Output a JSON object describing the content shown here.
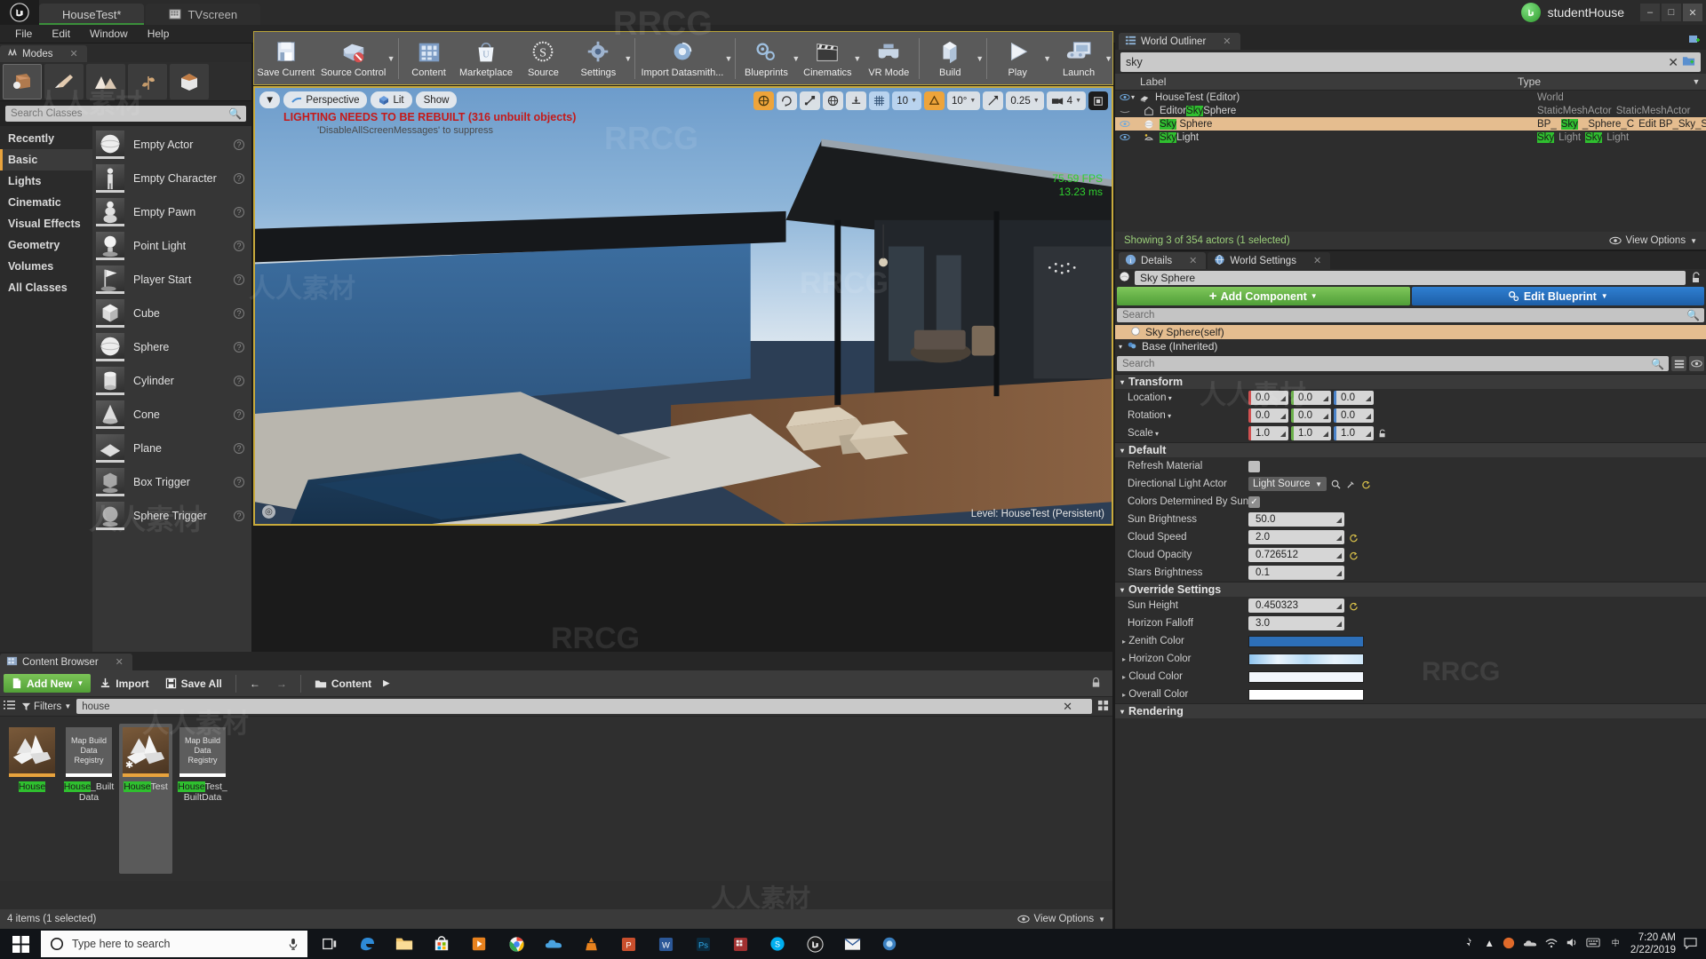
{
  "title_bar": {
    "tabs": [
      {
        "label": "HouseTest*",
        "icon": "unreal-logo-icon",
        "active": true
      },
      {
        "label": "TVscreen",
        "icon": "tvscreen-icon",
        "active": false
      }
    ],
    "account_name": "studentHouse",
    "window_controls": [
      "minimize",
      "maximize",
      "close"
    ]
  },
  "menu_bar": {
    "items": [
      "File",
      "Edit",
      "Window",
      "Help"
    ]
  },
  "modes_panel": {
    "tab_label": "Modes",
    "mode_buttons": [
      "place-mode-icon",
      "paint-mode-icon",
      "landscape-mode-icon",
      "foliage-mode-icon",
      "geometry-mode-icon"
    ],
    "search_placeholder": "Search Classes",
    "search_value": "",
    "categories": [
      {
        "label": "Recently Placed",
        "active": false
      },
      {
        "label": "Basic",
        "active": true
      },
      {
        "label": "Lights",
        "active": false
      },
      {
        "label": "Cinematic",
        "active": false
      },
      {
        "label": "Visual Effects",
        "active": false
      },
      {
        "label": "Geometry",
        "active": false
      },
      {
        "label": "Volumes",
        "active": false
      },
      {
        "label": "All Classes",
        "active": false
      }
    ],
    "placeables": [
      {
        "label": "Empty Actor",
        "icon": "sphere-thumb"
      },
      {
        "label": "Empty Character",
        "icon": "character-thumb"
      },
      {
        "label": "Empty Pawn",
        "icon": "pawn-thumb"
      },
      {
        "label": "Point Light",
        "icon": "bulb-thumb"
      },
      {
        "label": "Player Start",
        "icon": "flag-thumb"
      },
      {
        "label": "Cube",
        "icon": "cube-thumb"
      },
      {
        "label": "Sphere",
        "icon": "sphere-thumb"
      },
      {
        "label": "Cylinder",
        "icon": "cylinder-thumb"
      },
      {
        "label": "Cone",
        "icon": "cone-thumb"
      },
      {
        "label": "Plane",
        "icon": "plane-thumb"
      },
      {
        "label": "Box Trigger",
        "icon": "boxtrigger-thumb"
      },
      {
        "label": "Sphere Trigger",
        "icon": "spheretrigger-thumb"
      }
    ]
  },
  "main_toolbar": {
    "items": [
      {
        "label": "Save Current",
        "icon": "floppy-icon",
        "caret": false
      },
      {
        "label": "Source Control",
        "icon": "source-control-icon",
        "caret": true
      },
      {
        "label": "Content",
        "icon": "content-grid-icon",
        "caret": false
      },
      {
        "label": "Marketplace",
        "icon": "marketplace-bag-icon",
        "caret": false
      },
      {
        "label": "Source",
        "icon": "source-s-icon",
        "caret": false
      },
      {
        "label": "Settings",
        "icon": "settings-gear-icon",
        "caret": true
      },
      {
        "label": "Import Datasmith...",
        "icon": "datasmith-icon",
        "caret": true
      },
      {
        "label": "Blueprints",
        "icon": "blueprint-icon",
        "caret": true
      },
      {
        "label": "Cinematics",
        "icon": "clapperboard-icon",
        "caret": true
      },
      {
        "label": "VR Mode",
        "icon": "vr-headset-icon",
        "caret": false
      },
      {
        "label": "Build",
        "icon": "build-icon",
        "caret": true
      },
      {
        "label": "Play",
        "icon": "play-triangle-icon",
        "caret": true
      },
      {
        "label": "Launch",
        "icon": "launch-gamepad-icon",
        "caret": true
      }
    ]
  },
  "viewport": {
    "view_caret": "viewport-options-caret",
    "perspective_label": "Perspective",
    "lit_label": "Lit",
    "show_label": "Show",
    "warning_line1": "LIGHTING NEEDS TO BE REBUILT (316 unbuilt objects)",
    "warning_line2": "'DisableAllScreenMessages' to suppress",
    "fps": "75.59 FPS",
    "frame_ms": "13.23 ms",
    "level_label": "Level:  HouseTest (Persistent)",
    "right_controls": [
      {
        "name": "transform-mode-icon",
        "value": ""
      },
      {
        "name": "rotate-mode-icon",
        "value": ""
      },
      {
        "name": "scale-mode-icon",
        "value": ""
      },
      {
        "name": "world-coords-icon",
        "value": ""
      },
      {
        "name": "surface-snap-icon",
        "value": ""
      },
      {
        "name": "grid-snap-icon",
        "value": ""
      },
      {
        "name": "grid-size-value",
        "value": "10"
      },
      {
        "name": "rotation-snap-icon",
        "value": ""
      },
      {
        "name": "rotation-snap-value",
        "value": "10°"
      },
      {
        "name": "scale-snap-icon",
        "value": ""
      },
      {
        "name": "scale-snap-value",
        "value": "0.25"
      },
      {
        "name": "camera-speed-icon",
        "value": ""
      },
      {
        "name": "camera-speed-value",
        "value": "4"
      },
      {
        "name": "maximize-viewport-icon",
        "value": ""
      }
    ]
  },
  "content_browser": {
    "tab_label": "Content Browser",
    "add_new_label": "Add New",
    "import_label": "Import",
    "save_all_label": "Save All",
    "breadcrumb": "Content",
    "filters_label": "Filters",
    "search_value": "house",
    "assets": [
      {
        "name_plain": "House",
        "name_parts": [
          {
            "t": "House",
            "hl": true
          }
        ],
        "type": "level",
        "selected": false
      },
      {
        "name_plain": "House_BuiltData",
        "name_parts": [
          {
            "t": "House",
            "hl": true
          },
          {
            "t": "_Built",
            "hl": false
          },
          {
            "t": "Data",
            "hl": false
          }
        ],
        "type": "mapbuild",
        "thumb_text": "Map Build Data Registry",
        "selected": false
      },
      {
        "name_plain": "HouseTest",
        "name_parts": [
          {
            "t": "House",
            "hl": true
          },
          {
            "t": "Test",
            "hl": false
          }
        ],
        "type": "level",
        "selected": true
      },
      {
        "name_plain": "HouseTest_BuiltData",
        "name_parts": [
          {
            "t": "House",
            "hl": true
          },
          {
            "t": "Test_",
            "hl": false
          },
          {
            "t": "BuiltData",
            "hl": false
          }
        ],
        "type": "mapbuild",
        "thumb_text": "Map Build Data Registry",
        "selected": false
      }
    ],
    "status_text": "4 items (1 selected)",
    "view_options_label": "View Options"
  },
  "world_outliner": {
    "tab_label": "World Outliner",
    "search_value": "sky",
    "columns": {
      "label": "Label",
      "type": "Type"
    },
    "rows": [
      {
        "label_parts": [
          {
            "t": "HouseTest (Editor)",
            "hl": false
          }
        ],
        "type_parts": [
          {
            "t": "World",
            "hl": false
          }
        ],
        "depth": 0,
        "icon": "world-icon",
        "eye": true,
        "selected": false,
        "expander": true
      },
      {
        "label_parts": [
          {
            "t": "Editor",
            "hl": false
          },
          {
            "t": "Sky",
            "hl": true
          },
          {
            "t": "Sphere",
            "hl": false
          }
        ],
        "type_parts": [
          {
            "t": "StaticMeshActor",
            "hl": false
          },
          {
            "t": "StaticMeshActor",
            "hl": false
          }
        ],
        "depth": 1,
        "icon": "staticmesh-icon",
        "eye": false,
        "selected": false,
        "expander": false
      },
      {
        "label_parts": [
          {
            "t": "Sky",
            "hl": true
          },
          {
            "t": " Sphere",
            "hl": false
          }
        ],
        "type_parts": [
          {
            "t": "BP_",
            "hl": false
          },
          {
            "t": "Sky",
            "hl": true
          },
          {
            "t": "_Sphere_C",
            "hl": false
          },
          {
            "t": "Edit BP_Sky_Sph",
            "hl": false
          }
        ],
        "depth": 1,
        "icon": "sphere-icon",
        "eye": true,
        "selected": true,
        "expander": false
      },
      {
        "label_parts": [
          {
            "t": "Sky",
            "hl": true
          },
          {
            "t": "Light",
            "hl": false
          }
        ],
        "type_parts": [
          {
            "t": "Sky",
            "hl": true
          },
          {
            "t": "Light",
            "hl": false
          },
          {
            "t": "Sky",
            "hl": true
          },
          {
            "t": "Light",
            "hl": false
          }
        ],
        "depth": 1,
        "icon": "skylight-icon",
        "eye": true,
        "selected": false,
        "expander": false
      }
    ],
    "footer_status": "Showing 3 of 354 actors (1 selected)",
    "view_options_label": "View Options"
  },
  "details_panel": {
    "tabs": [
      {
        "label": "Details",
        "icon": "details-info-icon",
        "active": true
      },
      {
        "label": "World Settings",
        "icon": "world-settings-icon",
        "active": false
      }
    ],
    "actor_name": "Sky Sphere",
    "add_component_label": "Add Component",
    "edit_blueprint_label": "Edit Blueprint",
    "component_search_placeholder": "Search",
    "components": [
      {
        "label": "Sky Sphere(self)",
        "selected": true,
        "expander": false
      },
      {
        "label": "Base (Inherited)",
        "selected": false,
        "expander": true
      }
    ],
    "property_search_placeholder": "Search",
    "sections": [
      {
        "title": "Transform",
        "rows": [
          {
            "name": "Location",
            "kind": "vector3",
            "dropdown": true,
            "values": [
              "0.0",
              "0.0",
              "0.0"
            ]
          },
          {
            "name": "Rotation",
            "kind": "vector3",
            "dropdown": true,
            "values": [
              "0.0",
              "0.0",
              "0.0"
            ]
          },
          {
            "name": "Scale",
            "kind": "vector3",
            "dropdown": true,
            "values": [
              "1.0",
              "1.0",
              "1.0"
            ],
            "lock": true
          }
        ]
      },
      {
        "title": "Default",
        "rows": [
          {
            "name": "Refresh Material",
            "kind": "checkbox",
            "checked": false
          },
          {
            "name": "Directional Light Actor",
            "kind": "object",
            "value": "Light Source"
          },
          {
            "name": "Colors Determined By Sun Positi",
            "kind": "checkbox",
            "checked": true
          },
          {
            "name": "Sun Brightness",
            "kind": "number",
            "value": "50.0",
            "reset": false
          },
          {
            "name": "Cloud Speed",
            "kind": "number",
            "value": "2.0",
            "reset": true
          },
          {
            "name": "Cloud Opacity",
            "kind": "number",
            "value": "0.726512",
            "reset": true
          },
          {
            "name": "Stars Brightness",
            "kind": "number",
            "value": "0.1",
            "reset": false
          }
        ]
      },
      {
        "title": "Override Settings",
        "rows": [
          {
            "name": "Sun Height",
            "kind": "number",
            "value": "0.450323",
            "reset": true
          },
          {
            "name": "Horizon Falloff",
            "kind": "number",
            "value": "3.0",
            "reset": false
          },
          {
            "name": "Zenith Color",
            "kind": "color",
            "color": "#2d6fb8",
            "expander": true
          },
          {
            "name": "Horizon Color",
            "kind": "color",
            "color": "#bfdcf5",
            "expander": true
          },
          {
            "name": "Cloud Color",
            "kind": "color",
            "color": "#f2f7fc",
            "expander": true
          },
          {
            "name": "Overall Color",
            "kind": "color",
            "color": "#ffffff",
            "expander": true
          }
        ]
      },
      {
        "title": "Rendering",
        "rows": []
      }
    ]
  },
  "taskbar": {
    "search_placeholder": "Type here to search",
    "apps": [
      "task-view-icon",
      "edge-icon",
      "file-explorer-icon",
      "microsoft-store-icon",
      "media-player-icon",
      "chrome-icon",
      "onedrive-icon",
      "vlc-icon",
      "powerpoint-icon",
      "word-icon",
      "photoshop-icon",
      "substance-icon",
      "skype-icon",
      "unreal-icon",
      "mail-icon",
      "app-icon"
    ],
    "time": "7:20 AM",
    "date": "2/22/2019"
  },
  "watermarks": [
    "RRCG",
    "人人素材"
  ]
}
